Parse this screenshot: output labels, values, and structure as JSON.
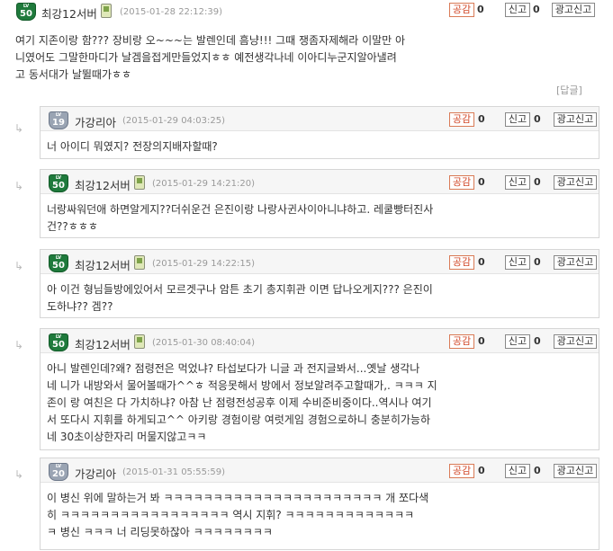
{
  "colors": {
    "like_border": "#d97a56",
    "like_text": "#d2492a",
    "badge_green": "#1f7a3c",
    "badge_gray": "#9aa4b3"
  },
  "labels": {
    "like": "공감",
    "report": "신고",
    "ad_report": "광고신고",
    "reply": "[답글]",
    "lv": "LV"
  },
  "main": {
    "level": "50",
    "nick": "최강12서버",
    "date": "(2015-01-28 22:12:39)",
    "like_count": "0",
    "report_count": "0",
    "lines": [
      "여기 지존이랑 함???  장비랑 오~~~는 발렌인데 흠냥!!! 그때 쟁좀자제해라 이말만 아",
      "니였어도 그말한마디가 날겜을접게만들었지ㅎㅎ 예전생각나네 이아디누군지알아낼려",
      "고 동서대가 날뛸때가ㅎㅎ"
    ]
  },
  "replies": [
    {
      "level": "19",
      "badge": "gray",
      "nick": "가강리아",
      "phone": false,
      "date": "(2015-01-29 04:03:25)",
      "like_count": "0",
      "report_count": "0",
      "lines": [
        "너 아이디 뭐였지? 전장의지배자할때?"
      ]
    },
    {
      "level": "50",
      "badge": "green",
      "nick": "최강12서버",
      "phone": true,
      "date": "(2015-01-29 14:21:20)",
      "like_count": "0",
      "report_count": "0",
      "lines": [
        "너랑싸워던애 하면알게지??더쉬운건 은진이랑 나랑사귄사이아니냐하고. 레쿨빵터진사",
        "건??ㅎㅎㅎ"
      ]
    },
    {
      "level": "50",
      "badge": "green",
      "nick": "최강12서버",
      "phone": true,
      "date": "(2015-01-29 14:22:15)",
      "like_count": "0",
      "report_count": "0",
      "lines": [
        "아 이건 형님들방에있어서 모르겟구나 암튼 초기 총지휘관 이면 답나오게지??? 은진이",
        "도하냐?? 겜??"
      ]
    },
    {
      "level": "50",
      "badge": "green",
      "nick": "최강12서버",
      "phone": true,
      "date": "(2015-01-30 08:40:04)",
      "like_count": "0",
      "report_count": "0",
      "lines": [
        "아니 발렌인데?왜? 점령전은 먹었냐? 타섭보다가 니글 과 전지글봐서...옛날 생각나",
        "네 니가 내방와서 물어볼때가^^ㅎ 적응못해서 방에서 정보알려주고할때가,. ㅋㅋㅋ 지",
        "존이 랑 여친은 다 가치하냐? 아참 난 점령전성공후 이제 수비준비중이다..역시나 여기",
        "서 또다시 지휘를 하게되고^^ 아키랑 경험이랑 여럿게임 경험으로하니 충분히가능하",
        "네 30초이상한자리 머물지않고ㅋㅋ"
      ]
    },
    {
      "level": "20",
      "badge": "gray",
      "nick": "가강리아",
      "phone": false,
      "date": "(2015-01-31 05:55:59)",
      "like_count": "0",
      "report_count": "0",
      "lines": [
        "이 병신 위에 말하는거 봐 ㅋㅋㅋㅋㅋㅋㅋㅋㅋㅋㅋㅋㅋㅋㅋㅋㅋㅋㅋㅋㅋㅋ 개 쪼다색",
        "히 ㅋㅋㅋㅋㅋㅋㅋㅋㅋㅋㅋㅋㅋㅋㅋㅋㅋ 역시 지휘? ㅋㅋㅋㅋㅋㅋㅋㅋㅋㅋㅋㅋㅋ",
        "ㅋ 병신 ㅋㅋㅋ 너 리딩못하잖아 ㅋㅋㅋㅋㅋㅋㅋㅋ"
      ]
    }
  ]
}
